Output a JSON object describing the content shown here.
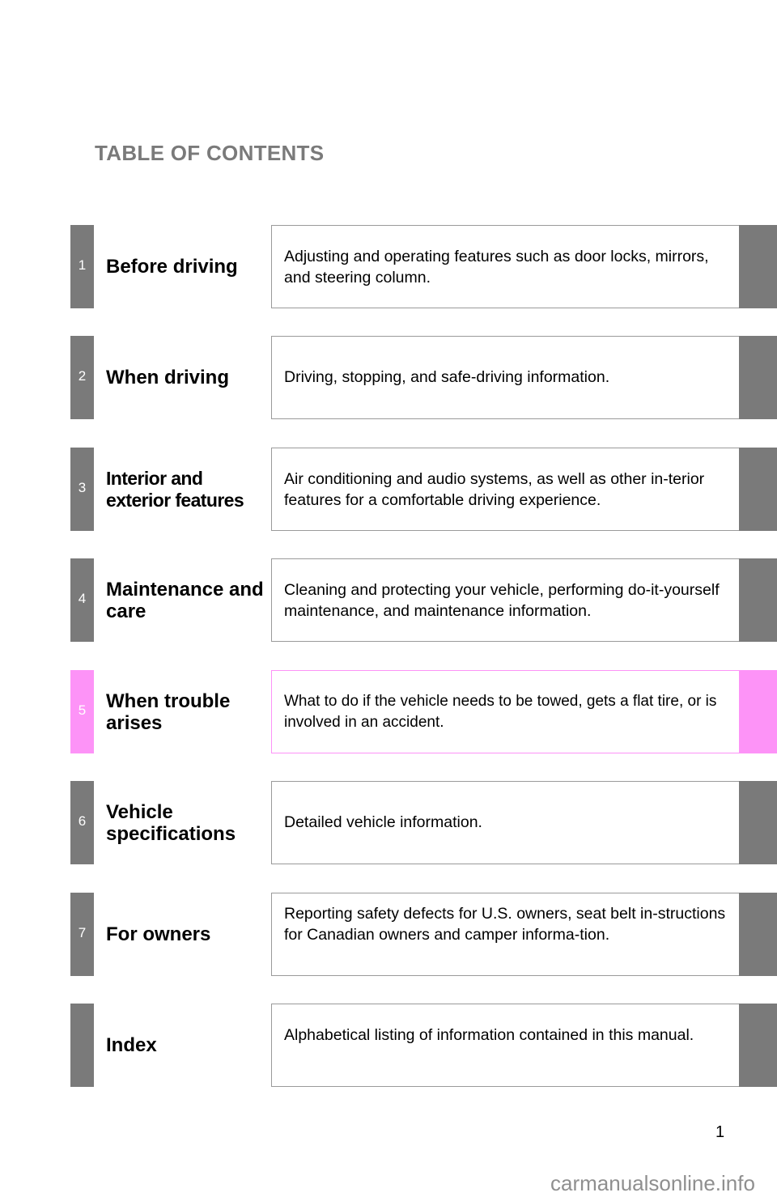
{
  "header": {
    "title": "TABLE OF CONTENTS"
  },
  "colors": {
    "tab_default": "#7a7a7a",
    "tab_highlight": "#fd93f7"
  },
  "sections": [
    {
      "number": "1",
      "title": "Before driving",
      "description": "Adjusting and operating features such as door locks, mirrors, and steering column."
    },
    {
      "number": "2",
      "title": "When driving",
      "description": "Driving, stopping, and safe-driving information."
    },
    {
      "number": "3",
      "title": "Interior and exterior features",
      "description": "Air conditioning and audio systems, as well as other in-terior features for a comfortable driving experience."
    },
    {
      "number": "4",
      "title": "Maintenance and care",
      "description": "Cleaning and protecting your vehicle, performing do-it-yourself maintenance, and maintenance information."
    },
    {
      "number": "5",
      "title": "When trouble arises",
      "description": "What to do if the vehicle needs to be towed, gets a flat tire, or is involved in an accident."
    },
    {
      "number": "6",
      "title": "Vehicle specifications",
      "description": "Detailed vehicle information."
    },
    {
      "number": "7",
      "title": "For owners",
      "description": "Reporting safety defects for U.S. owners, seat belt in-structions for Canadian owners and camper informa-tion."
    },
    {
      "number": "",
      "title": "Index",
      "description": "Alphabetical listing of information contained in this manual."
    }
  ],
  "footer": {
    "page_number": "1",
    "watermark": "carmanualsonline.info"
  }
}
